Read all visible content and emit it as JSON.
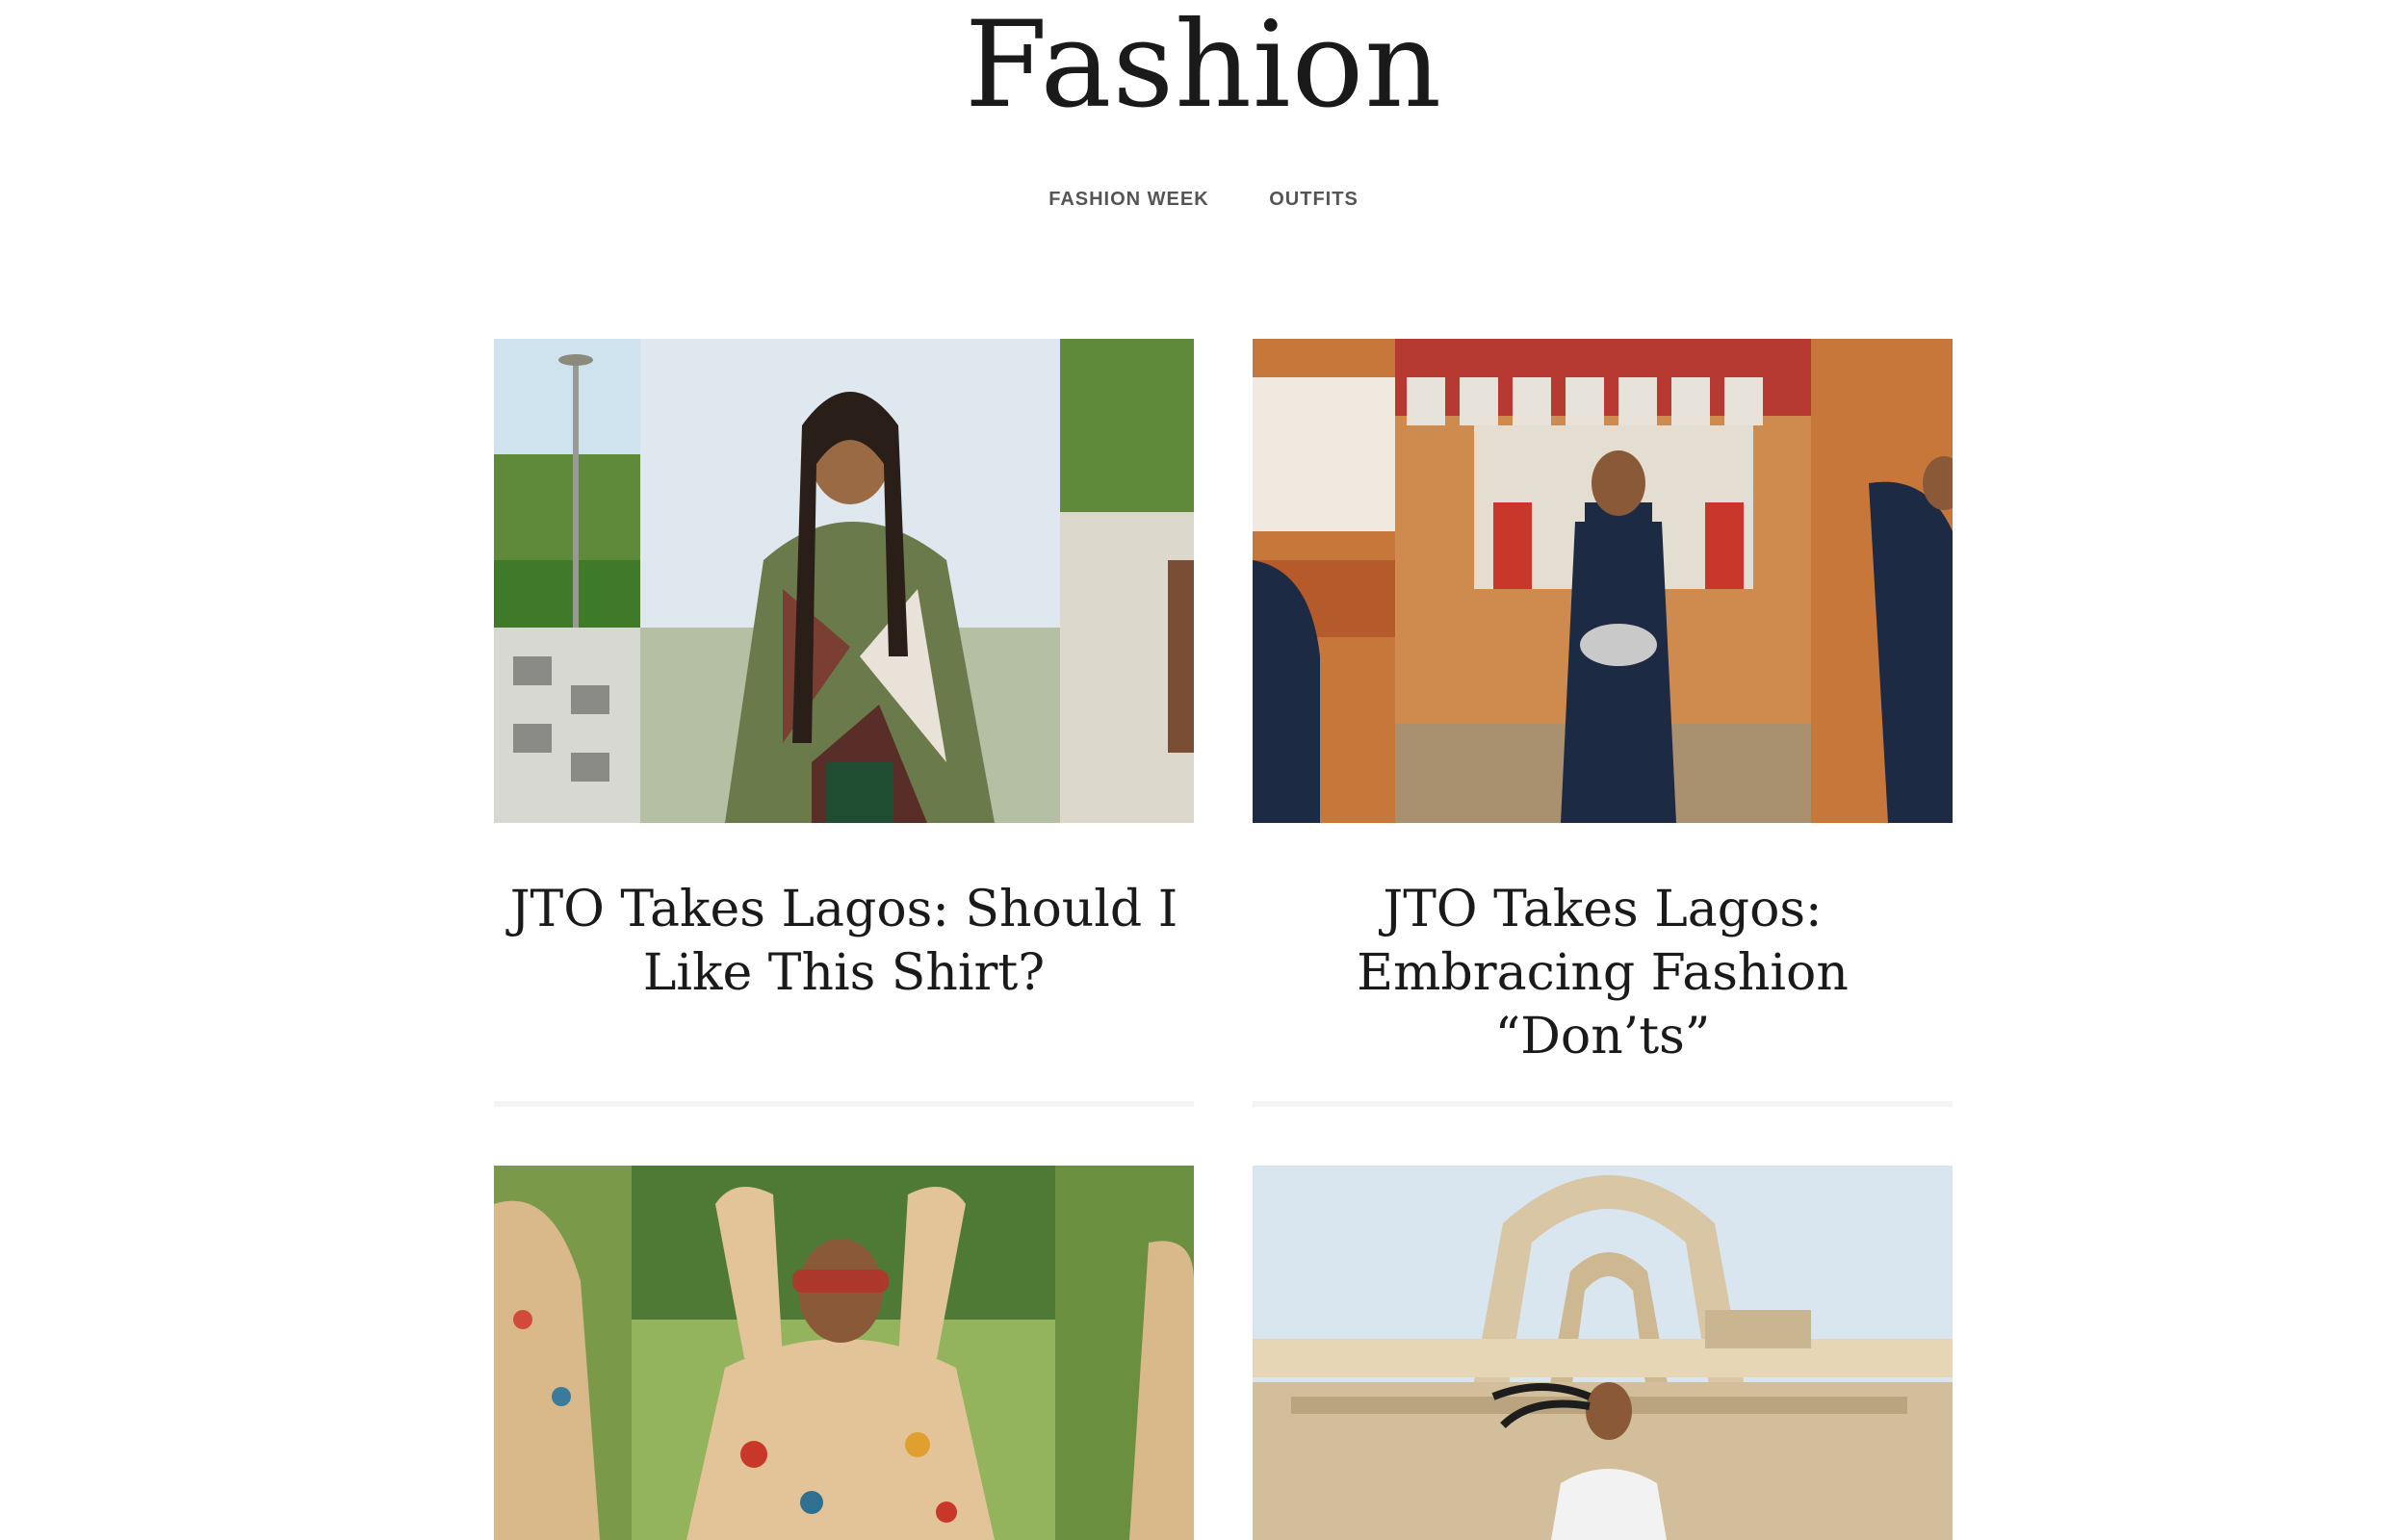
{
  "page": {
    "title": "Fashion"
  },
  "nav": {
    "items": [
      {
        "label": "FASHION WEEK"
      },
      {
        "label": "OUTFITS"
      }
    ]
  },
  "posts": [
    {
      "title": "JTO Takes Lagos: Should I Like This Shirt?"
    },
    {
      "title": "JTO Takes Lagos: Embracing Fashion “Don’ts”"
    },
    {
      "title": ""
    },
    {
      "title": ""
    }
  ],
  "colors": {
    "text": "#1a1a1a",
    "nav_text": "#555555",
    "divider": "#f4f4f4"
  }
}
